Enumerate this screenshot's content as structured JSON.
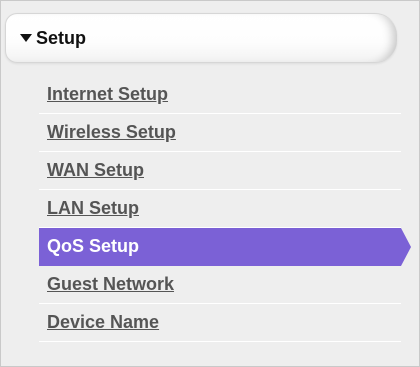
{
  "header": {
    "title": "Setup",
    "expand_icon": "triangle-down-icon"
  },
  "menu": {
    "items": [
      {
        "label": "Internet Setup"
      },
      {
        "label": "Wireless Setup"
      },
      {
        "label": "WAN Setup"
      },
      {
        "label": "LAN Setup"
      },
      {
        "label": "QoS Setup"
      },
      {
        "label": "Guest Network"
      },
      {
        "label": "Device Name"
      }
    ],
    "active_index": 4
  },
  "colors": {
    "active_background": "#7b61d6",
    "active_text": "#ffffff",
    "item_text": "#555555",
    "panel_background": "#eeeeee"
  }
}
